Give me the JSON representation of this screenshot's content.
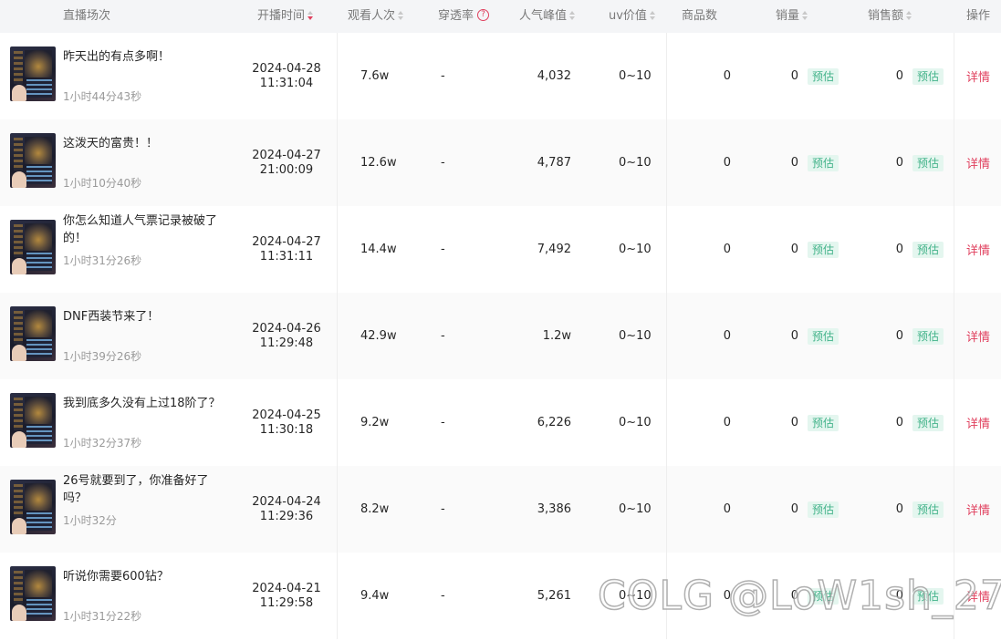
{
  "header": {
    "session": "直播场次",
    "start_time": "开播时间",
    "views": "观看人次",
    "penetration": "穿透率",
    "peak": "人气峰值",
    "uv": "uv价值",
    "product_count": "商品数",
    "sales_volume": "销量",
    "sales_amount": "销售额",
    "action": "操作",
    "help_glyph": "?"
  },
  "sort_icon": "sort-arrows-icon",
  "active_sort": "start_time",
  "accent_color": "#e0405e",
  "estimate_color": "#43b38a",
  "rows": [
    {
      "title": "昨天出的有点多啊！",
      "duration": "1小时44分43秒",
      "date": "2024-04-28",
      "time": "11:31:04",
      "views": "7.6w",
      "penetration": "-",
      "peak": "4,032",
      "uv": "0~10",
      "product_count": "0",
      "sales_volume": "0",
      "sales_badge": "预估",
      "sales_amount": "0",
      "amount_badge": "预估",
      "action": "详情"
    },
    {
      "title": "这泼天的富贵！！",
      "duration": "1小时10分40秒",
      "date": "2024-04-27",
      "time": "21:00:09",
      "views": "12.6w",
      "penetration": "-",
      "peak": "4,787",
      "uv": "0~10",
      "product_count": "0",
      "sales_volume": "0",
      "sales_badge": "预估",
      "sales_amount": "0",
      "amount_badge": "预估",
      "action": "详情"
    },
    {
      "title": "你怎么知道人气票记录被破了的！",
      "duration": "1小时31分26秒",
      "date": "2024-04-27",
      "time": "11:31:11",
      "views": "14.4w",
      "penetration": "-",
      "peak": "7,492",
      "uv": "0~10",
      "product_count": "0",
      "sales_volume": "0",
      "sales_badge": "预估",
      "sales_amount": "0",
      "amount_badge": "预估",
      "action": "详情"
    },
    {
      "title": "DNF西装节来了！",
      "duration": "1小时39分26秒",
      "date": "2024-04-26",
      "time": "11:29:48",
      "views": "42.9w",
      "penetration": "-",
      "peak": "1.2w",
      "uv": "0~10",
      "product_count": "0",
      "sales_volume": "0",
      "sales_badge": "预估",
      "sales_amount": "0",
      "amount_badge": "预估",
      "action": "详情"
    },
    {
      "title": "我到底多久没有上过18阶了？",
      "duration": "1小时32分37秒",
      "date": "2024-04-25",
      "time": "11:30:18",
      "views": "9.2w",
      "penetration": "-",
      "peak": "6,226",
      "uv": "0~10",
      "product_count": "0",
      "sales_volume": "0",
      "sales_badge": "预估",
      "sales_amount": "0",
      "amount_badge": "预估",
      "action": "详情"
    },
    {
      "title": "26号就要到了，你准备好了吗？",
      "duration": "1小时32分",
      "date": "2024-04-24",
      "time": "11:29:36",
      "views": "8.2w",
      "penetration": "-",
      "peak": "3,386",
      "uv": "0~10",
      "product_count": "0",
      "sales_volume": "0",
      "sales_badge": "预估",
      "sales_amount": "0",
      "amount_badge": "预估",
      "action": "详情"
    },
    {
      "title": "听说你需要600钻？",
      "duration": "1小时31分22秒",
      "date": "2024-04-21",
      "time": "11:29:58",
      "views": "9.4w",
      "penetration": "-",
      "peak": "5,261",
      "uv": "0~10",
      "product_count": "0",
      "sales_volume": "0",
      "sales_badge": "预估",
      "sales_amount": "0",
      "amount_badge": "预估",
      "action": "详情"
    }
  ],
  "watermark": "COLG @LoW1sh_27"
}
